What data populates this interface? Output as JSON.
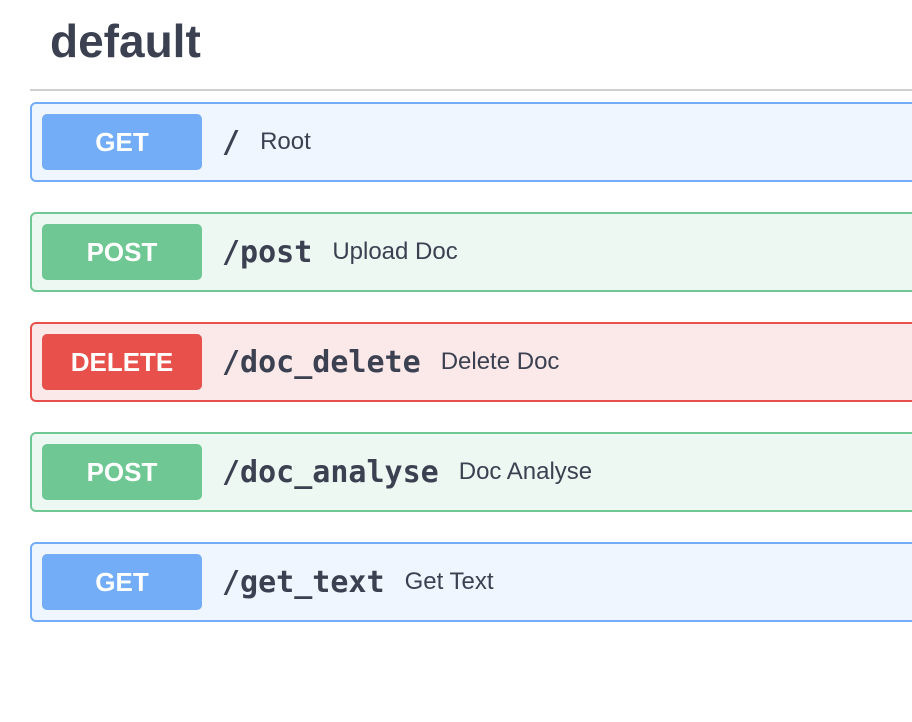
{
  "section": {
    "title": "default"
  },
  "operations": [
    {
      "method": "GET",
      "path": "/",
      "summary": "Root"
    },
    {
      "method": "POST",
      "path": "/post",
      "summary": "Upload Doc"
    },
    {
      "method": "DELETE",
      "path": "/doc_delete",
      "summary": "Delete Doc"
    },
    {
      "method": "POST",
      "path": "/doc_analyse",
      "summary": "Doc Analyse"
    },
    {
      "method": "GET",
      "path": "/get_text",
      "summary": "Get Text"
    }
  ],
  "colors": {
    "get": "#74adf7",
    "post": "#6fc893",
    "delete": "#e8504b"
  }
}
